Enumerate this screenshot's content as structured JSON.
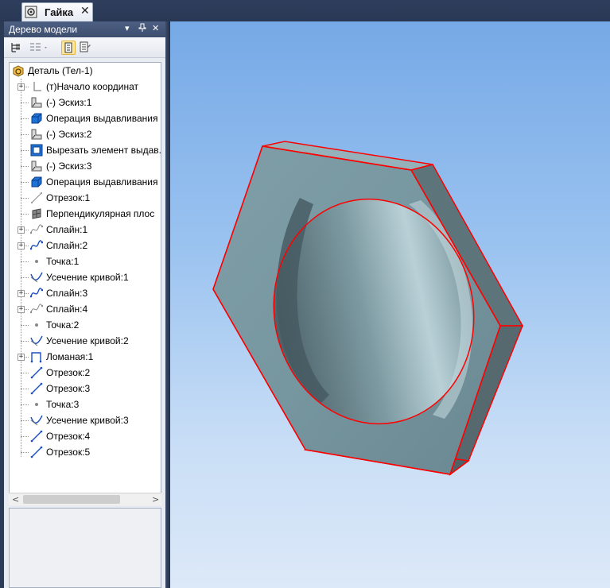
{
  "tab": {
    "title": "Гайка",
    "close": "✕",
    "icon": "part-document-icon"
  },
  "panel": {
    "title": "Дерево модели",
    "menu_glyph": "▾",
    "pin_glyph": "⊥",
    "close_glyph": "✕"
  },
  "toolbar": {
    "buttons": [
      "tree-structure-icon",
      "tree-list-dropdown-icon",
      "document-view-icon",
      "properties-view-icon"
    ],
    "active_button": "document-view-icon"
  },
  "tree": {
    "root": "Деталь (Тел-1)",
    "items": [
      {
        "label": "(т)Начало координат",
        "expandable": true,
        "icon": "origin-icon"
      },
      {
        "label": "(-) Эскиз:1",
        "expandable": false,
        "icon": "sketch-icon"
      },
      {
        "label": "Операция выдавливания",
        "expandable": false,
        "icon": "extrude-icon"
      },
      {
        "label": "(-) Эскиз:2",
        "expandable": false,
        "icon": "sketch-icon"
      },
      {
        "label": "Вырезать элемент выдав.",
        "expandable": false,
        "icon": "cut-extrude-icon"
      },
      {
        "label": "(-) Эскиз:3",
        "expandable": false,
        "icon": "sketch-icon"
      },
      {
        "label": "Операция выдавливания",
        "expandable": false,
        "icon": "extrude-icon"
      },
      {
        "label": "Отрезок:1",
        "expandable": false,
        "icon": "segment-gray-icon"
      },
      {
        "label": "Перпендикулярная плос",
        "expandable": false,
        "icon": "plane-icon"
      },
      {
        "label": "Сплайн:1",
        "expandable": true,
        "icon": "spline-gray-icon"
      },
      {
        "label": "Сплайн:2",
        "expandable": true,
        "icon": "spline-icon"
      },
      {
        "label": "Точка:1",
        "expandable": false,
        "icon": "point-icon"
      },
      {
        "label": "Усечение кривой:1",
        "expandable": false,
        "icon": "trim-curve-icon"
      },
      {
        "label": "Сплайн:3",
        "expandable": true,
        "icon": "spline-icon"
      },
      {
        "label": "Сплайн:4",
        "expandable": true,
        "icon": "spline-gray-icon"
      },
      {
        "label": "Точка:2",
        "expandable": false,
        "icon": "point-icon"
      },
      {
        "label": "Усечение кривой:2",
        "expandable": false,
        "icon": "trim-curve-icon"
      },
      {
        "label": "Ломаная:1",
        "expandable": true,
        "icon": "polyline-icon"
      },
      {
        "label": "Отрезок:2",
        "expandable": false,
        "icon": "segment-icon"
      },
      {
        "label": "Отрезок:3",
        "expandable": false,
        "icon": "segment-icon"
      },
      {
        "label": "Точка:3",
        "expandable": false,
        "icon": "point-icon"
      },
      {
        "label": "Усечение кривой:3",
        "expandable": false,
        "icon": "trim-curve-icon"
      },
      {
        "label": "Отрезок:4",
        "expandable": false,
        "icon": "segment-icon"
      },
      {
        "label": "Отрезок:5",
        "expandable": false,
        "icon": "segment-icon"
      }
    ]
  },
  "scrollbar": {
    "left": "<",
    "right": ">"
  },
  "viewport": {
    "model": "hex-nut",
    "edge_color": "#ff0000"
  },
  "colors": {
    "face": "#7a9aa3",
    "side": "#5b7178",
    "viewport_top": "#76a9e6",
    "viewport_bottom": "#dce9f8"
  }
}
